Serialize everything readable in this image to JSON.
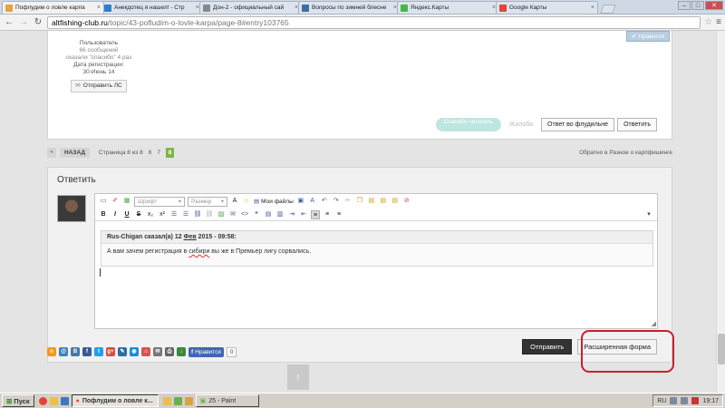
{
  "browser": {
    "tabs": [
      {
        "title": "Пофлудим о ловле карпа",
        "color": "#e8a33d",
        "active": true
      },
      {
        "title": "Анекдотец я нашел! - Стр",
        "color": "#2e7dd1",
        "active": false
      },
      {
        "title": "Дон-2 - официальный сай",
        "color": "#888888",
        "active": false
      },
      {
        "title": "Вопросы по зимней блесне",
        "color": "#3a6ea5",
        "active": false
      },
      {
        "title": "Яндекс.Карты",
        "color": "#46b847",
        "active": false
      },
      {
        "title": "Google Карты",
        "color": "#e94235",
        "active": false
      }
    ],
    "url_domain": "altfishing-club.ru",
    "url_path": "/topic/43-pofludim-o-lovle-karpa/page-8#entry103765"
  },
  "post": {
    "user_role": "Пользователь",
    "messages": "66 сообщений",
    "thanks": "сказали \"спасибо\" 4 раз",
    "reg_label": "Дата регистрации:",
    "reg_date": "30-Июнь 14",
    "pm_button": "Отправить ЛС",
    "like_button": "Нравится",
    "thanks_button": "Спасибо читатель",
    "complain": "Жалоба",
    "reply_flood": "Ответ во флудильне",
    "reply": "Ответить"
  },
  "pager": {
    "prev": "«",
    "back": "НАЗАД",
    "text": "Страница 8 из 8",
    "pages": [
      "6",
      "7"
    ],
    "current": "8",
    "back_link": "Обратно в Разное о карпфишинге"
  },
  "reply_box": {
    "title": "Ответить",
    "font_placeholder": "Шрифт",
    "size_placeholder": "Размер",
    "my_files": "Мои файлы",
    "quote_author": "Rus-Chigan сказал(а) 12 ",
    "quote_month": "Фев",
    "quote_time": " 2015 - 09:58:",
    "quote_text_a": "А вам зачем регистрация в ",
    "quote_text_misspelled": "сибири",
    "quote_text_b": " вы же в Премьер лигу сорвались.",
    "send": "Отправить",
    "extended": "Расширенная форма"
  },
  "social": {
    "like": "Нравится",
    "count": "0",
    "icons": [
      {
        "name": "odnoklassniki-icon",
        "color": "#f59a1b",
        "glyph": "о"
      },
      {
        "name": "mailru-icon",
        "color": "#3d7fc9",
        "glyph": "@"
      },
      {
        "name": "vkontakte-icon",
        "color": "#4a76a8",
        "glyph": "В"
      },
      {
        "name": "facebook-icon",
        "color": "#3b5998",
        "glyph": "f"
      },
      {
        "name": "twitter-icon",
        "color": "#1da1f2",
        "glyph": "t"
      },
      {
        "name": "googleplus-icon",
        "color": "#dd4b39",
        "glyph": "g+"
      },
      {
        "name": "livejournal-icon",
        "color": "#2e6da4",
        "glyph": "✎"
      },
      {
        "name": "moimir-icon",
        "color": "#168de2",
        "glyph": "◉"
      },
      {
        "name": "home-icon",
        "color": "#d9534f",
        "glyph": "⌂"
      },
      {
        "name": "email-icon",
        "color": "#777777",
        "glyph": "✉"
      },
      {
        "name": "print-icon",
        "color": "#666666",
        "glyph": "⎙"
      },
      {
        "name": "download-icon",
        "color": "#3a8a3a",
        "glyph": "↓"
      }
    ]
  },
  "taskbar": {
    "start": "Пуск",
    "active_task": "Пофлудим о ловле к...",
    "paint_task": "25 - Paint",
    "lang": "RU",
    "time": "19:17"
  }
}
